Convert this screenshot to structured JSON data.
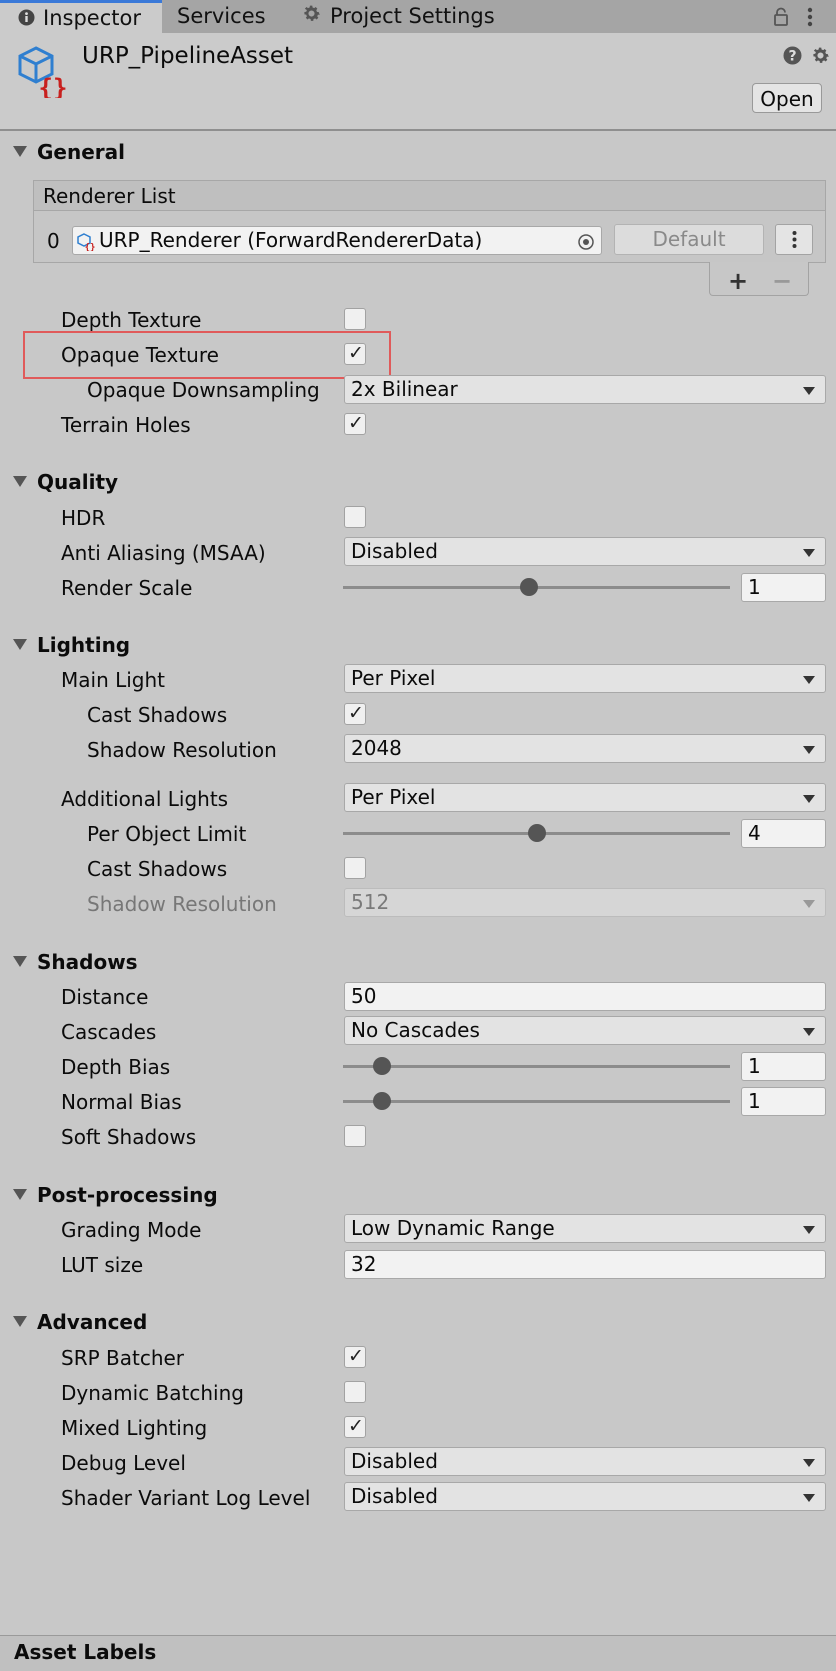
{
  "tabs": {
    "inspector": "Inspector",
    "services": "Services",
    "project_settings": "Project Settings"
  },
  "header": {
    "title": "URP_PipelineAsset",
    "open_button": "Open"
  },
  "general": {
    "title": "General",
    "renderer_list": {
      "heading": "Renderer List",
      "index": "0",
      "renderer": "URP_Renderer (ForwardRendererData)",
      "default_button": "Default"
    },
    "depth_texture": {
      "label": "Depth Texture",
      "checked": false
    },
    "opaque_texture": {
      "label": "Opaque Texture",
      "checked": true
    },
    "opaque_downsampling": {
      "label": "Opaque Downsampling",
      "value": "2x Bilinear"
    },
    "terrain_holes": {
      "label": "Terrain Holes",
      "checked": true
    }
  },
  "quality": {
    "title": "Quality",
    "hdr": {
      "label": "HDR",
      "checked": false
    },
    "anti_aliasing": {
      "label": "Anti Aliasing (MSAA)",
      "value": "Disabled"
    },
    "render_scale": {
      "label": "Render Scale",
      "value": "1",
      "slider_fraction": 0.48
    }
  },
  "lighting": {
    "title": "Lighting",
    "main_light": {
      "label": "Main Light",
      "value": "Per Pixel"
    },
    "main_cast_shadows": {
      "label": "Cast Shadows",
      "checked": true
    },
    "main_shadow_resolution": {
      "label": "Shadow Resolution",
      "value": "2048"
    },
    "additional_lights": {
      "label": "Additional Lights",
      "value": "Per Pixel"
    },
    "per_object_limit": {
      "label": "Per Object Limit",
      "value": "4",
      "slider_fraction": 0.5
    },
    "additional_cast_shadows": {
      "label": "Cast Shadows",
      "checked": false
    },
    "additional_shadow_resolution": {
      "label": "Shadow Resolution",
      "value": "512"
    }
  },
  "shadows": {
    "title": "Shadows",
    "distance": {
      "label": "Distance",
      "value": "50"
    },
    "cascades": {
      "label": "Cascades",
      "value": "No Cascades"
    },
    "depth_bias": {
      "label": "Depth Bias",
      "value": "1",
      "slider_fraction": 0.1
    },
    "normal_bias": {
      "label": "Normal Bias",
      "value": "1",
      "slider_fraction": 0.1
    },
    "soft_shadows": {
      "label": "Soft Shadows",
      "checked": false
    }
  },
  "post_processing": {
    "title": "Post-processing",
    "grading_mode": {
      "label": "Grading Mode",
      "value": "Low Dynamic Range"
    },
    "lut_size": {
      "label": "LUT size",
      "value": "32"
    }
  },
  "advanced": {
    "title": "Advanced",
    "srp_batcher": {
      "label": "SRP Batcher",
      "checked": true
    },
    "dynamic_batching": {
      "label": "Dynamic Batching",
      "checked": false
    },
    "mixed_lighting": {
      "label": "Mixed Lighting",
      "checked": true
    },
    "debug_level": {
      "label": "Debug Level",
      "value": "Disabled"
    },
    "shader_variant_log_level": {
      "label": "Shader Variant Log Level",
      "value": "Disabled"
    }
  },
  "footer": {
    "asset_labels": "Asset Labels"
  },
  "colors": {
    "highlight": "#e05a5a",
    "active_tab_accent": "#3a79d8",
    "asset_icon_blue": "#2f7fd0",
    "asset_icon_red": "#c8201e"
  }
}
